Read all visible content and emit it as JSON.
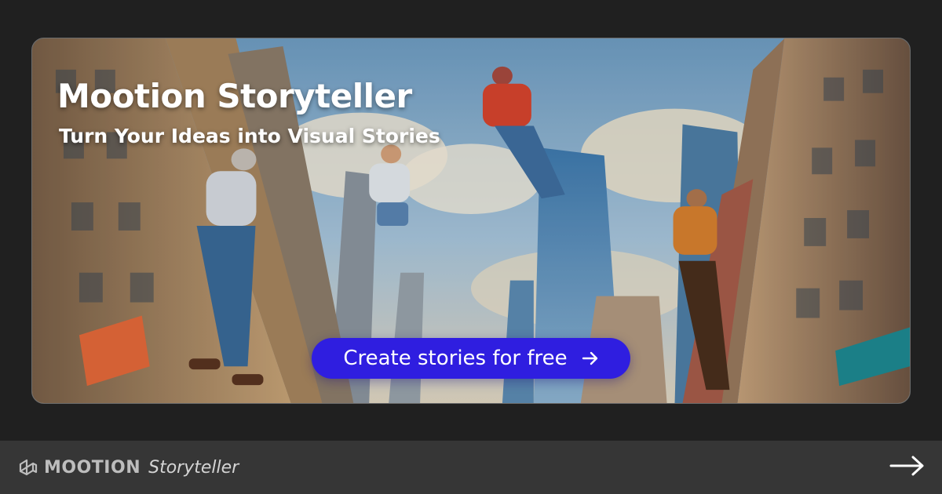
{
  "hero": {
    "title": "Mootion Storyteller",
    "subtitle": "Turn Your Ideas into Visual Stories",
    "cta_label": "Create stories for free",
    "cta_icon": "arrow-right-icon",
    "cta_color": "#2f1ee0",
    "illustration": "people-jumping-between-skyscrapers-illustration"
  },
  "footer": {
    "brand_icon": "mootion-logo-icon",
    "brand_name": "MOOTION",
    "product_name": "Storyteller",
    "arrow_icon": "arrow-right-icon",
    "background": "#363636"
  },
  "colors": {
    "page_background": "#202020",
    "text": "#ffffff"
  }
}
